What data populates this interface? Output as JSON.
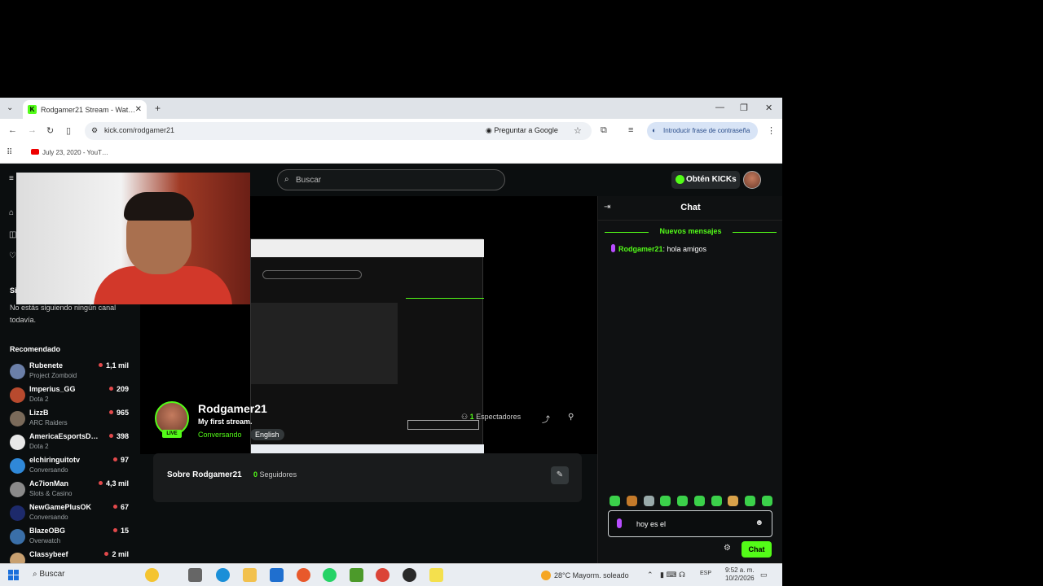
{
  "browser": {
    "tab_title": "Rodgamer21 Stream - Wat…",
    "url": "kick.com/rodgamer21",
    "ask_google": "Preguntar a Google",
    "password_chip": "Introducir frase de contraseña",
    "bookmark": "July 23, 2020 - YouT…"
  },
  "header": {
    "search_placeholder": "Buscar",
    "kicks_label": "Obtén KICKs"
  },
  "sidebar": {
    "following_title": "Si",
    "following_empty": "No estás siguiendo ningún canal todavía.",
    "recommended_title": "Recomendado",
    "recommended": [
      {
        "name": "Rubenete",
        "category": "Project Zomboid",
        "viewers": "1,1 mil",
        "color": "#6b7fa8"
      },
      {
        "name": "Imperius_GG",
        "category": "Dota 2",
        "viewers": "209",
        "color": "#b84a2e"
      },
      {
        "name": "LizzB",
        "category": "ARC Raiders",
        "viewers": "965",
        "color": "#7a6a5a"
      },
      {
        "name": "AmericaEsportsD…",
        "category": "Dota 2",
        "viewers": "398",
        "color": "#e8e8e8"
      },
      {
        "name": "elchiringuitotv",
        "category": "Conversando",
        "viewers": "97",
        "color": "#2f88d8"
      },
      {
        "name": "Ac7ionMan",
        "category": "Slots & Casino",
        "viewers": "4,3 mil",
        "color": "#8a8a8a"
      },
      {
        "name": "NewGamePlusOK",
        "category": "Conversando",
        "viewers": "67",
        "color": "#1d2a6b"
      },
      {
        "name": "BlazeOBG",
        "category": "Overwatch",
        "viewers": "15",
        "color": "#3a6fa8"
      },
      {
        "name": "Classybeef",
        "category": "",
        "viewers": "2 mil",
        "color": "#c8a070"
      }
    ]
  },
  "channel": {
    "name": "Rodgamer21",
    "live_badge": "LIVE",
    "stream_title": "My first stream.",
    "category": "Conversando",
    "language": "English",
    "viewers_count": "1",
    "viewers_label": "Espectadores",
    "about_title": "Sobre Rodgamer21",
    "followers_count": "0",
    "followers_label": "Seguidores"
  },
  "chat": {
    "title": "Chat",
    "new_messages": "Nuevos mensajes",
    "messages": [
      {
        "user": "Rodgamer21",
        "text": ": hola amigos"
      }
    ],
    "input_value": "hoy es el",
    "send_label": "Chat"
  },
  "taskbar": {
    "search_label": "Buscar",
    "weather": "28°C  Mayorm. soleado",
    "language": "ESP",
    "time": "9:52 a. m.",
    "date": "10/2/2026"
  }
}
